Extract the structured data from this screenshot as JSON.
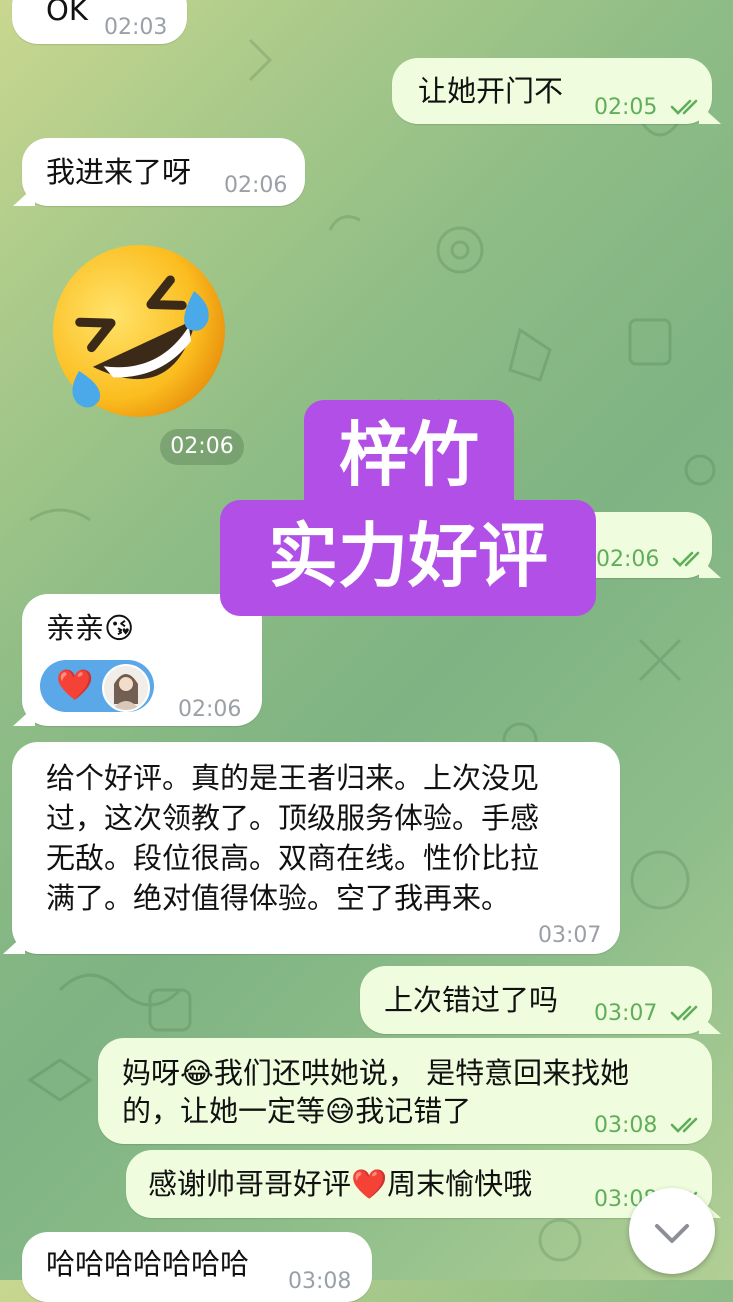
{
  "messages": [
    {
      "id": "m1",
      "text": "OK",
      "time": "02:03"
    },
    {
      "id": "m2",
      "text": "让她开门不",
      "time": "02:05"
    },
    {
      "id": "m3",
      "text": "我进来了呀",
      "time": "02:06"
    },
    {
      "id": "m4",
      "sticker": "rolling-on-floor-laughing-emoji",
      "time": "02:06"
    },
    {
      "id": "m5",
      "time": "02:06"
    },
    {
      "id": "m6",
      "text": "亲亲😘",
      "reaction": "❤️",
      "time": "02:06"
    },
    {
      "id": "m7",
      "lines": [
        "给个好评。真的是王者归来。上次没见",
        "过，这次领教了。顶级服务体验。手感",
        "无敌。段位很高。双商在线。性价比拉",
        "满了。绝对值得体验。空了我再来。"
      ],
      "time": "03:07"
    },
    {
      "id": "m8",
      "text": "上次错过了吗",
      "time": "03:07"
    },
    {
      "id": "m9",
      "lines": [
        "妈呀😂我们还哄她说， 是特意回来找她",
        "的，让她一定等😅我记错了"
      ],
      "time": "03:08"
    },
    {
      "id": "m10",
      "text": "感谢帅哥哥好评❤️周末愉快哦",
      "time": "03:08"
    },
    {
      "id": "m11",
      "text": "哈哈哈哈哈哈哈",
      "time": "03:08"
    }
  ],
  "overlay": {
    "line1": "梓竹",
    "line2": "实力好评"
  },
  "icons": {
    "read_receipt": "double-check-icon",
    "scroll": "chevron-down-icon"
  },
  "colors": {
    "incoming": "#ffffff",
    "outgoing": "#effdde",
    "check": "#5fae5a",
    "overlay": "#b14fe7",
    "reaction": "#5aa8e8"
  }
}
